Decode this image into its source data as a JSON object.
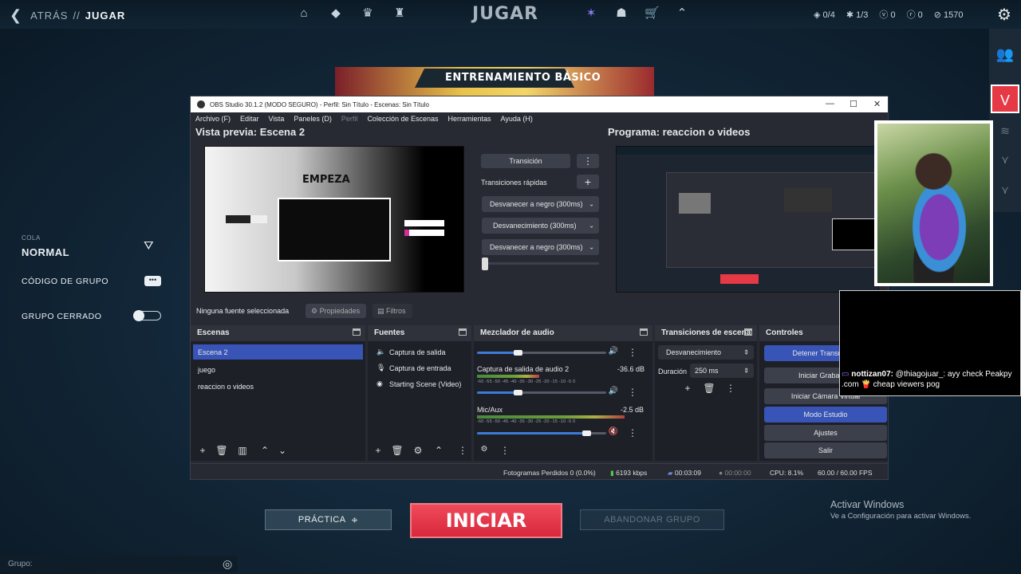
{
  "topbar": {
    "back_label": "ATRÁS",
    "separator": "//",
    "current": "JUGAR",
    "title": "JUGAR",
    "nav_icons": [
      "home-icon",
      "career-icon",
      "agents-icon",
      "collection-icon"
    ],
    "right_icons": [
      "battlepass-icon",
      "armory-icon",
      "store-icon",
      "rank-icon"
    ],
    "stat_agents": "0/4",
    "stat_radianite": "1/3",
    "stat_vp": "0",
    "stat_rp": "0",
    "stat_kc": "1570"
  },
  "queue": {
    "label": "COLA",
    "mode": "NORMAL",
    "group_code_label": "CÓDIGO DE GRUPO",
    "closed_group_label": "GRUPO CERRADO"
  },
  "banner": {
    "title": "ENTRENAMIENTO BÁSICO"
  },
  "obs": {
    "window_title": "OBS Studio 30.1.2 (MODO SEGURO) - Perfil: Sin Título - Escenas: Sin Título",
    "menu": [
      "Archivo (F)",
      "Editar",
      "Vista",
      "Paneles (D)",
      "Perfil",
      "Colección de Escenas",
      "Herramientas",
      "Ayuda (H)"
    ],
    "preview_title": "Vista previa: Escena 2",
    "program_title": "Programa: reaccion o videos",
    "preview_text": "EMPEZA",
    "transition_button": "Transición",
    "quick_transitions_label": "Transiciones rápidas",
    "quick_transitions": [
      "Desvanecer a negro (300ms)",
      "Desvanecimiento (300ms)",
      "Desvanecer a negro (300ms)"
    ],
    "no_source": "Ninguna fuente seleccionada",
    "properties": "Propiedades",
    "filters": "Filtros",
    "panels": {
      "scenes": "Escenas",
      "sources": "Fuentes",
      "mixer": "Mezclador de audio",
      "transitions": "Transiciones de escena",
      "controls": "Controles"
    },
    "scenes": [
      "Escena 2",
      "juego",
      "reaccion o videos"
    ],
    "sources": [
      "Captura de salida",
      "Captura de entrada",
      "Starting Scene (Video)"
    ],
    "mixer": {
      "ticks": "-60 -55 -50 -45 -40 -35 -30 -25 -20 -15 -10 -5 0",
      "channels": [
        {
          "name": "Captura de salida de audio 2",
          "db": "-36.6 dB",
          "level": 0.38
        },
        {
          "name": "Mic/Aux",
          "db": "-2.5 dB",
          "level": 0.9
        }
      ]
    },
    "transition_type": "Desvanecimiento",
    "duration_label": "Duración",
    "duration_value": "250 ms",
    "controls": [
      "Detener Transmisión",
      "Iniciar Grabación",
      "Iniciar Cámara Virtual",
      "Modo Estudio",
      "Ajustes",
      "Salir"
    ],
    "status": {
      "frames": "Fotogramas Perdidos 0 (0.0%)",
      "kbps": "6193 kbps",
      "stream_time": "00:03:09",
      "rec_time": "00:00:00",
      "cpu": "CPU: 8.1%",
      "fps": "60.00 / 60.00 FPS"
    }
  },
  "bottom": {
    "practice": "PRÁCTICA",
    "start": "INICIAR",
    "leave_group": "ABANDONAR GRUPO",
    "group_label": "Grupo:"
  },
  "windows_activation": {
    "title": "Activar Windows",
    "subtitle": "Ve a Configuración para activar Windows."
  },
  "chat": {
    "user": "nottizan07:",
    "message": "@thiagojuar_: ayy check Peakpy .com 🍟 cheap viewers pog"
  },
  "colors": {
    "accent_red": "#e63946",
    "obs_blue": "#3754b6",
    "obs_bg": "#272a33"
  }
}
